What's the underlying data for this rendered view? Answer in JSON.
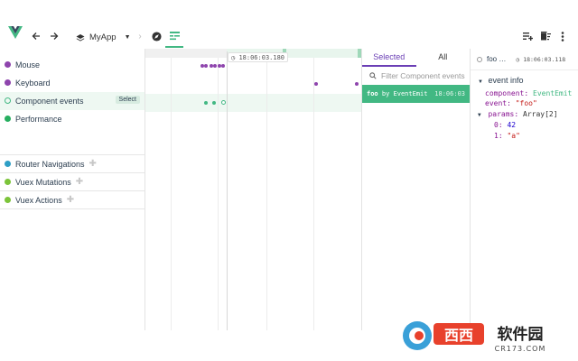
{
  "toolbar": {
    "app_name": "MyApp"
  },
  "layers": [
    {
      "label": "Mouse",
      "color": "#8e44ad"
    },
    {
      "label": "Keyboard",
      "color": "#8e44ad"
    },
    {
      "label": "Component events",
      "color": "#42b883",
      "selected": true,
      "action": "Select"
    },
    {
      "label": "Performance",
      "color": "#27ae60"
    },
    {
      "label": "Router Navigations",
      "color": "#2f9fc6",
      "plugin": true
    },
    {
      "label": "Vuex Mutations",
      "color": "#7cc43a",
      "plugin": true
    },
    {
      "label": "Vuex Actions",
      "color": "#7cc43a",
      "plugin": true
    }
  ],
  "timeline": {
    "cursor_time": "18:06:03.180"
  },
  "events_panel": {
    "tabs": [
      "Selected",
      "All"
    ],
    "active_tab": "Selected",
    "filter_placeholder": "Filter Component events",
    "items": [
      {
        "name": "foo",
        "by": "by EventEmit",
        "time": "18:06:03"
      }
    ]
  },
  "inspector": {
    "event_name": "foo …",
    "time": "18:06:03.118",
    "section": "event info",
    "fields": {
      "component_key": "component:",
      "component_val": "EventEmit",
      "event_key": "event:",
      "event_val": "\"foo\"",
      "params_key": "params:",
      "params_val": "Array[2]",
      "p0_key": "0:",
      "p0_val": "42",
      "p1_key": "1:",
      "p1_val": "\"a\""
    }
  },
  "watermark": {
    "site": "西西软件园",
    "domain": "CR173.COM"
  }
}
